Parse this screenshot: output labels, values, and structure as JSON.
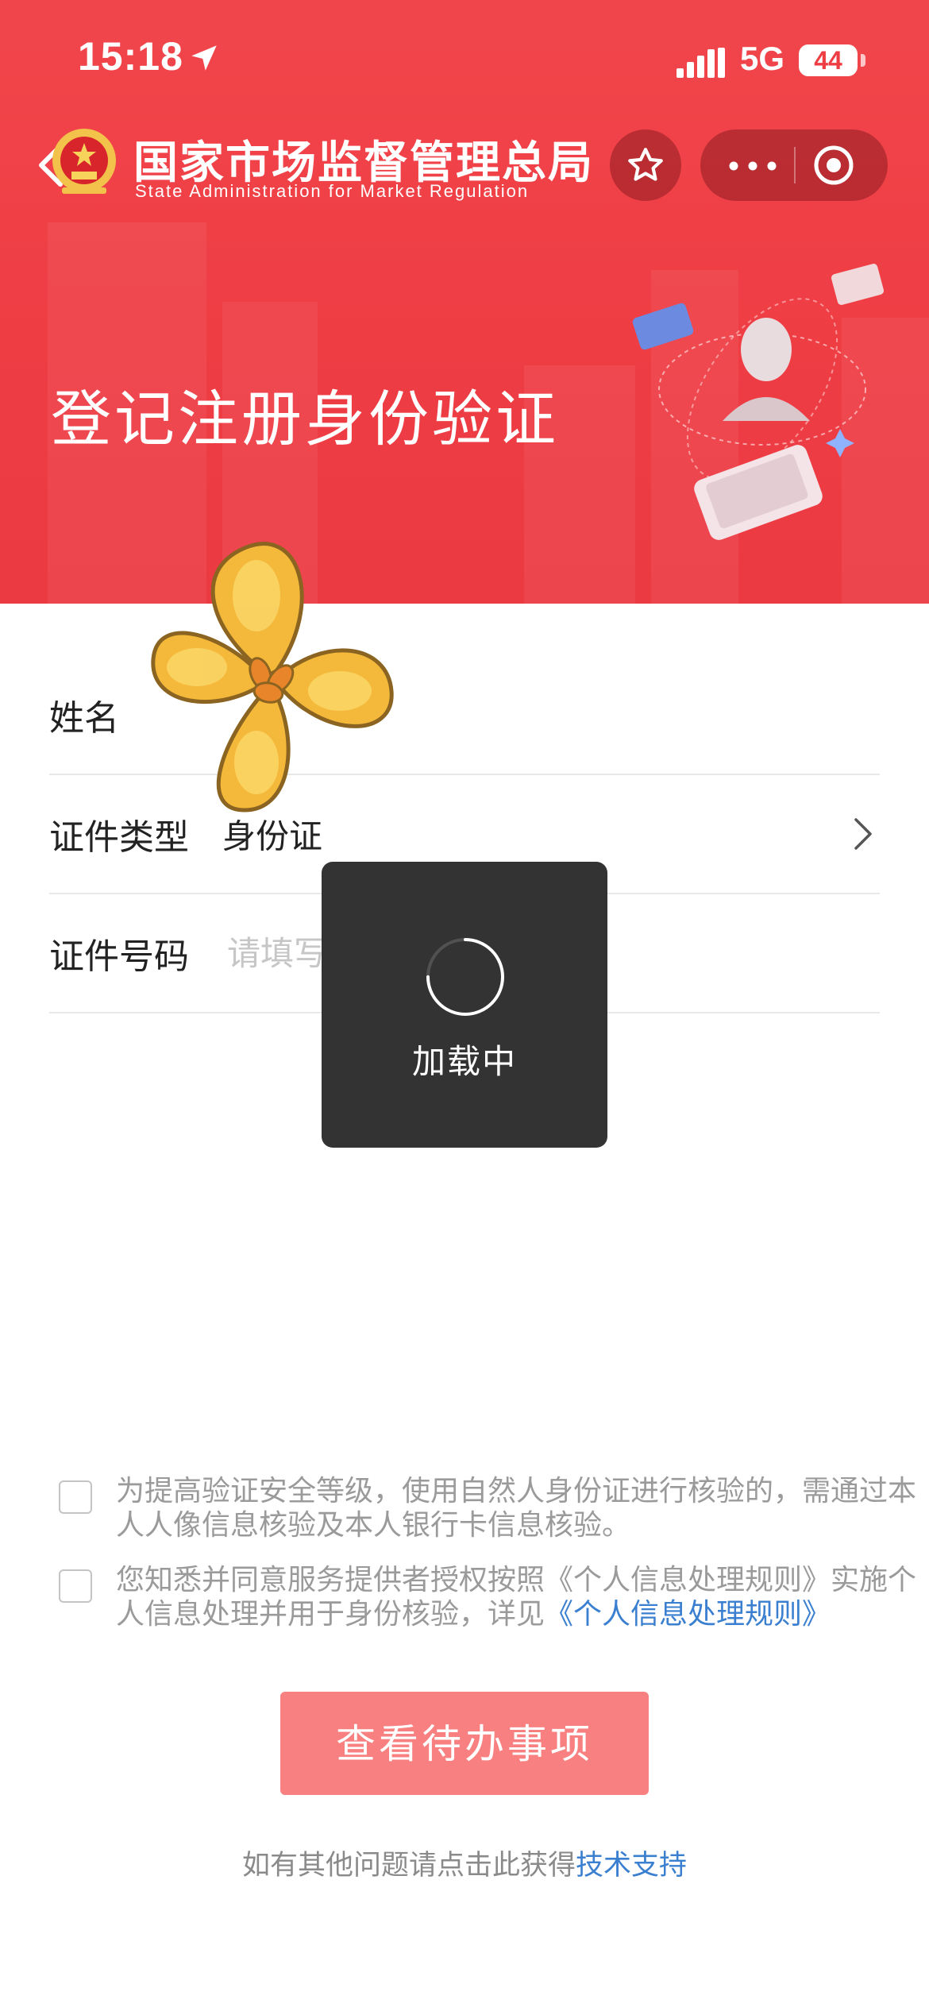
{
  "status_bar": {
    "time": "15:18",
    "network": "5G",
    "battery": "44"
  },
  "header": {
    "brand_cn": "国家市场监督管理总局",
    "brand_en": "State Administration for Market Regulation",
    "page_title": "登记注册身份验证"
  },
  "form": {
    "name_label": "姓名",
    "id_type_label": "证件类型",
    "id_type_value": "身份证",
    "id_number_label": "证件号码",
    "id_number_placeholder": "请填写证件号码"
  },
  "loading": {
    "text": "加载中"
  },
  "agreements": [
    {
      "text": "为提高验证安全等级，使用自然人身份证进行核验的，需通过本人人像信息核验及本人银行卡信息核验。"
    },
    {
      "text_before": "您知悉并同意服务提供者授权按照《个人信息处理规则》实施个人信息处理并用于身份核验，详见",
      "link": "《个人信息处理规则》"
    }
  ],
  "primary_button": "查看待办事项",
  "help": {
    "text": "如有其他问题请点击此获得",
    "link": "技术支持"
  },
  "colors": {
    "header_red": "#ef3d44",
    "button_pink": "#f98080",
    "link_blue": "#3a7fd0",
    "toast_bg": "#333333"
  },
  "icons": [
    "location-arrow-icon",
    "signal-icon",
    "back-icon",
    "national-emblem-icon",
    "star-icon",
    "more-icon",
    "target-icon",
    "chevron-right-icon",
    "loading-spinner-icon",
    "flower-sticker"
  ]
}
